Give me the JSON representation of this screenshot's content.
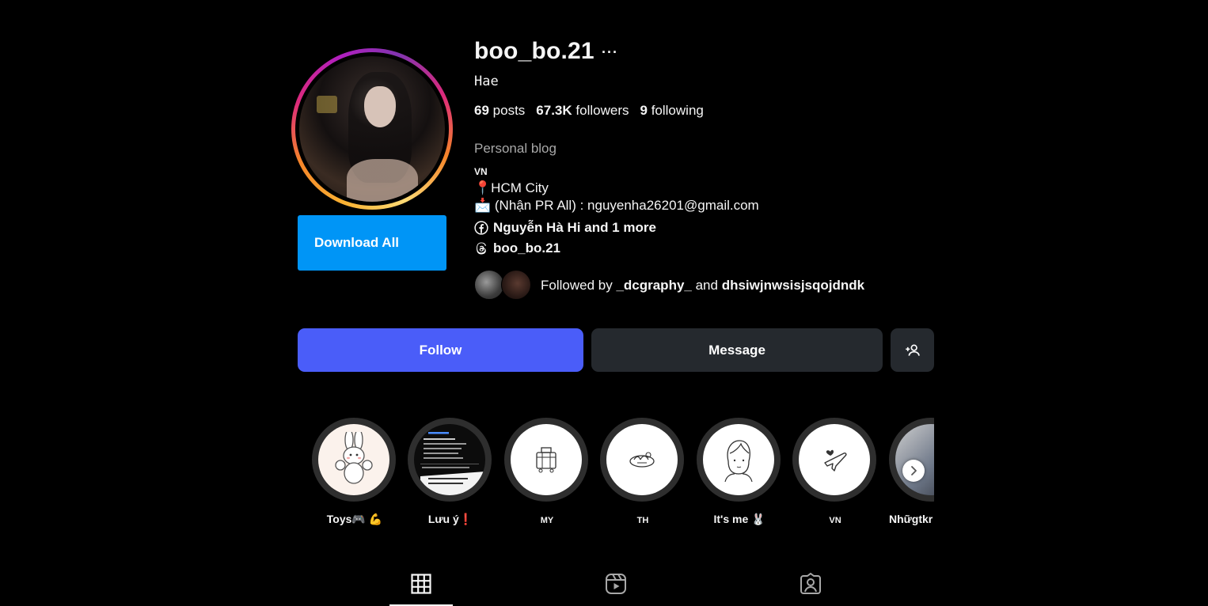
{
  "profile": {
    "username": "boo_bo.21",
    "more": "···",
    "full_name": "Hae",
    "stats": {
      "posts": "69",
      "posts_label": "posts",
      "followers": "67.3K",
      "followers_label": "followers",
      "following": "9",
      "following_label": "following"
    },
    "category": "Personal blog",
    "bio": {
      "line1": "VN",
      "line2": "📍HCM City",
      "line3": "📩 (Nhận PR All) : nguyenha26201@gmail.com"
    },
    "links": {
      "facebook": "Nguyễn Hà Hi and 1 more",
      "threads": "boo_bo.21"
    },
    "followed_by": {
      "prefix": "Followed by ",
      "user1": "_dcgraphy_",
      "joiner": " and ",
      "user2": "dhsiwjnwsisjsqojdndk"
    }
  },
  "actions": {
    "download_all": "Download All",
    "follow": "Follow",
    "message": "Message",
    "add_user_icon": "person-add-icon"
  },
  "highlights": [
    {
      "label": "Toys🎮 💪",
      "icon": "bunny"
    },
    {
      "label": "Lưu ý❗",
      "icon": "screenshot"
    },
    {
      "label": "MY",
      "icon": "suitcase"
    },
    {
      "label": "TH",
      "icon": "food"
    },
    {
      "label": "It's me 🐰",
      "icon": "girl-sketch"
    },
    {
      "label": "VN",
      "icon": "airplane"
    },
    {
      "label": "Nhữgtkr",
      "icon": "photo"
    }
  ],
  "tabs": [
    {
      "name": "posts",
      "icon": "grid-icon",
      "active": true
    },
    {
      "name": "reels",
      "icon": "reels-icon",
      "active": false
    },
    {
      "name": "tagged",
      "icon": "tagged-icon",
      "active": false
    }
  ],
  "colors": {
    "background": "#000000",
    "primary_blue": "#0095f6",
    "follow_button": "#4a5df9",
    "secondary_button": "#25292e",
    "muted_text": "#a8a8a8"
  }
}
